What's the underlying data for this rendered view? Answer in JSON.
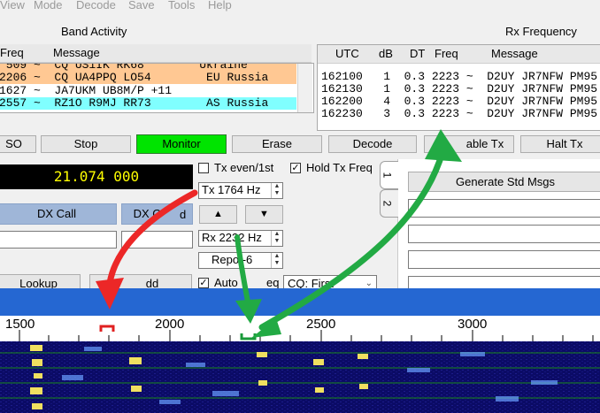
{
  "menu": [
    "View",
    "Mode",
    "Decode",
    "Save",
    "Tools",
    "Help"
  ],
  "band_activity": {
    "title": "Band Activity",
    "headers": [
      "Freq",
      "Message"
    ],
    "rows": [
      {
        "text": " 509 ~  CQ US1IK RK68        Ukraine",
        "bg": "#ffc893"
      },
      {
        "text": "2206 ~  CQ UA4PPQ LO54        EU Russia",
        "bg": "#ffc893"
      },
      {
        "text": "1627 ~  JA7UKM UB8M/P +11",
        "bg": "#ffffff"
      },
      {
        "text": "2557 ~  RZ1O R9MJ RR73        AS Russia",
        "bg": "#80ffff"
      }
    ]
  },
  "rx_frequency": {
    "title": "Rx Frequency",
    "headers": [
      "UTC",
      "dB",
      "DT",
      "Freq",
      "Message"
    ],
    "rows": [
      "162100   1  0.3 2223 ~  D2UY JR7NFW PM95",
      "162130   1  0.3 2223 ~  D2UY JR7NFW PM95",
      "162200   4  0.3 2223 ~  D2UY JR7NFW PM95",
      "162230   3  0.3 2223 ~  D2UY JR7NFW PM95"
    ]
  },
  "buttons": {
    "log_qso": "SO",
    "stop": "Stop",
    "monitor": "Monitor",
    "erase": "Erase",
    "decode": "Decode",
    "enable_tx": "able Tx",
    "halt_tx": "Halt Tx"
  },
  "dial_frequency": "21.074 000",
  "controls": {
    "tx_even": "Tx even/1st",
    "hold_tx": "Hold Tx Freq",
    "tx_freq": "Tx  1764  Hz",
    "rx_freq": "Rx  2232  Hz",
    "report": "Repo   -6",
    "auto_seq": "Auto",
    "auto_seq_tail": "eq",
    "cq_select": "CQ: First",
    "up_arrow": "▲",
    "down_arrow": "▼"
  },
  "dx": {
    "dx_call": "DX Call",
    "dx_grid": "DX G",
    "dx_grid_tail": "d",
    "lookup": "Lookup",
    "add": "dd"
  },
  "tabs": [
    "1",
    "2"
  ],
  "generate_std_msgs": "Generate Std Msgs",
  "ruler": {
    "ticks": [
      "1500",
      "2000",
      "2500",
      "3000"
    ]
  },
  "colors": {
    "monitor_green": "#00e400",
    "wf_blue": "#2567d2",
    "arrow_red": "#ec2727",
    "arrow_green": "#22aa44",
    "marker_red": "#e02020",
    "marker_green": "#1a9a3a"
  }
}
